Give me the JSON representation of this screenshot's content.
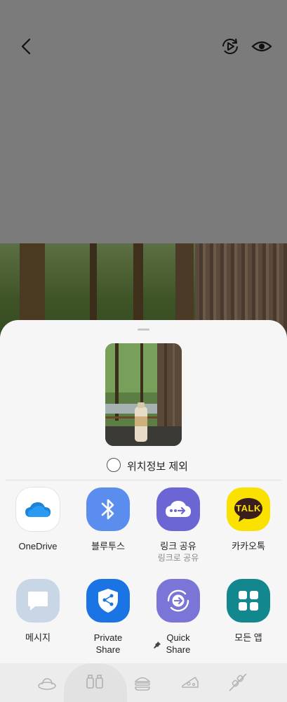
{
  "share_sheet": {
    "exclude_location_label": "위치정보 제외",
    "apps_row1": [
      {
        "label": "OneDrive",
        "sub": ""
      },
      {
        "label": "블루투스",
        "sub": ""
      },
      {
        "label": "링크 공유",
        "sub": "링크로 공유"
      },
      {
        "label": "카카오톡",
        "sub": ""
      }
    ],
    "apps_row2": [
      {
        "label": "메시지"
      },
      {
        "label": "Private Share"
      },
      {
        "label": "Quick Share"
      },
      {
        "label": "모든 앱"
      }
    ],
    "kakao_icon_text": "TALK"
  },
  "icons": {
    "back": "back-arrow-icon",
    "rotate": "rotate-play-icon",
    "view": "eye-icon",
    "pin": "pin-icon"
  },
  "colors": {
    "bluetooth": "#5b8def",
    "link_share": "#6b66d3",
    "kakao": "#fae100",
    "message": "#c8d6e6",
    "private_share": "#1b74e4",
    "quick_share": "#7c75d8",
    "all_apps": "#13878e"
  }
}
